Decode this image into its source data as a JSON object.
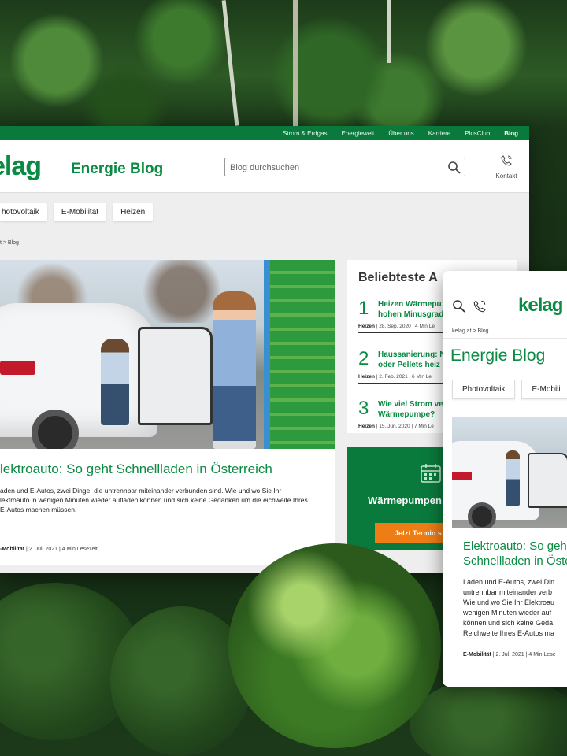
{
  "topnav": [
    "Strom & Erdgas",
    "Energiewelt",
    "Über uns",
    "Karriere",
    "PlusClub",
    "Blog"
  ],
  "brand": {
    "logo": "kelag",
    "logo_desktop": "elag",
    "blog_title": "Energie Blog"
  },
  "search": {
    "placeholder": "Blog durchsuchen"
  },
  "contact": {
    "label": "Kontakt"
  },
  "categories": [
    "hotovoltaik",
    "E-Mobilität",
    "Heizen"
  ],
  "breadcrumb": {
    "desktop": "t > Blog",
    "mobile": "kelag.at > Blog"
  },
  "article": {
    "title": "lektroauto: So geht Schnellladen in Österreich",
    "excerpt": "aden und E-Autos, zwei Dinge, die untrennbar miteinander verbunden sind. Wie und wo Sie Ihr lektroauto in wenigen Minuten wieder aufladen können und sich keine Gedanken um die eichweite Ihres E-Autos machen müssen.",
    "category": "-Mobilität",
    "meta": " | 2. Jul. 2021 | 4 Min Lesezeit"
  },
  "popular": {
    "heading": "Beliebteste A",
    "items": [
      {
        "num": "1",
        "title1": "Heizen Wärmepu",
        "title2": "hohen Minusgrad",
        "cat": "Heizen",
        "meta": " | 28. Sep. 2020 | 4 Min Le"
      },
      {
        "num": "2",
        "title1": "Haussanierung: N",
        "title2": "oder Pellets heiz",
        "cat": "Heizen",
        "meta": " | 2. Feb. 2021 | 6 Min Le"
      },
      {
        "num": "3",
        "title1": "Wie viel Strom ve",
        "title2": "Wärmepumpe?",
        "cat": "Heizen",
        "meta": " | 15. Jun. 2020 | 7 Min Le"
      }
    ]
  },
  "promo": {
    "title": "Wärmepumpen",
    "button": "Jetzt Termin s"
  },
  "mobile": {
    "logo": "kelag",
    "title": "Energie Blog",
    "categories": [
      "Photovoltaik",
      "E-Mobili"
    ],
    "article_title_1": "Elektroauto: So geht",
    "article_title_2": "Schnellladen in Öste",
    "excerpt": "Laden und E-Autos, zwei Din\nuntrennbar miteinander verb\nWie und wo Sie Ihr Elektroau\nwenigen Minuten wieder auf\nkönnen und sich keine Geda\nReichweite Ihres E-Autos ma",
    "category": "E-Mobilität",
    "meta": " | 2. Jul. 2021 | 4 Min Lese"
  },
  "colors": {
    "brand_green": "#0a8a42",
    "topbar_green": "#0a7a3c",
    "cta_orange": "#ef7d16"
  }
}
